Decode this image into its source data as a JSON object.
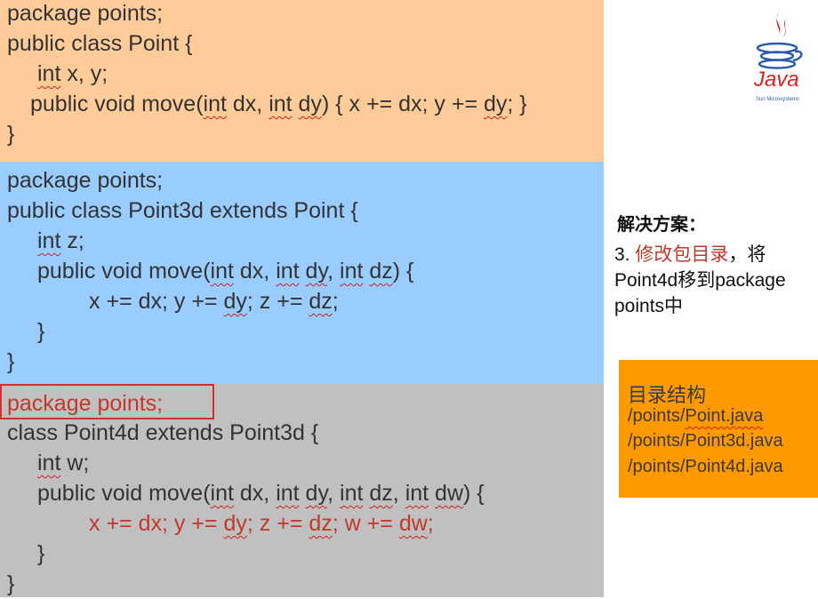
{
  "panel1": {
    "color": "#ffcc99",
    "l1": "package points;",
    "l2": "public class Point {",
    "l3_kw": "int",
    "l3_rest": " x, y;",
    "l4_a": "public void move(",
    "l4_int1": "int",
    "l4_b": " dx, ",
    "l4_int2": "int",
    "l4_c": " ",
    "l4_dy": "dy",
    "l4_d": ") { x += dx; y += ",
    "l4_dy2": "dy",
    "l4_e": "; }",
    "l5": "}"
  },
  "panel2": {
    "color": "#99ccff",
    "l1": "package points;",
    "l2": "public class Point3d extends Point {",
    "l3_kw": "int",
    "l3_rest": " z;",
    "l4_a": "public void move(",
    "l4_int1": "int",
    "l4_b": " dx, ",
    "l4_int2": "int",
    "l4_c": " ",
    "l4_dy": "dy",
    "l4_d": ", ",
    "l4_int3": "int",
    "l4_e": " ",
    "l4_dz": "dz",
    "l4_f": ") {",
    "l5_a": "x += dx; y += ",
    "l5_dy": "dy",
    "l5_b": "; z += ",
    "l5_dz": "dz",
    "l5_c": ";",
    "l6": "}",
    "l7": "}"
  },
  "panel3": {
    "color": "#c0c0c0",
    "l1": "package points;",
    "l2": "class Point4d extends Point3d {",
    "l3_kw": "int",
    "l3_rest": " w;",
    "l4_a": "public void move(",
    "l4_int1": "int",
    "l4_b": " dx, ",
    "l4_int2": "int",
    "l4_c": " ",
    "l4_dy": "dy",
    "l4_d": ", ",
    "l4_int3": "int",
    "l4_e": " ",
    "l4_dz": "dz",
    "l4_f": ", ",
    "l4_int4": "int",
    "l4_g": " ",
    "l4_dw": "dw",
    "l4_h": ") {",
    "l5_a": "x += dx; y += ",
    "l5_dy": "dy",
    "l5_b": "; z += ",
    "l5_dz": "dz",
    "l5_c": "; w += ",
    "l5_dw": "dw",
    "l5_d": ";",
    "l6": "}",
    "l7": "}"
  },
  "logo": {
    "text": "Java",
    "subtext": "Sun Microsystems"
  },
  "solution": {
    "heading": "解决方案：",
    "num": "3. ",
    "highlight": "修改包目录",
    "sep": "，将",
    "rest": "Point4d移到package points中"
  },
  "directory": {
    "title": "目录结构",
    "path1_dir": "/points/",
    "path1_file": "Point.java",
    "path2": "/points/Point3d.java",
    "path3": "/points/Point4d.java",
    "color": "#ff9900"
  },
  "colors": {
    "highlight_red": "#c0392b",
    "logo_red": "#e02020",
    "logo_blue": "#2a5caa"
  }
}
